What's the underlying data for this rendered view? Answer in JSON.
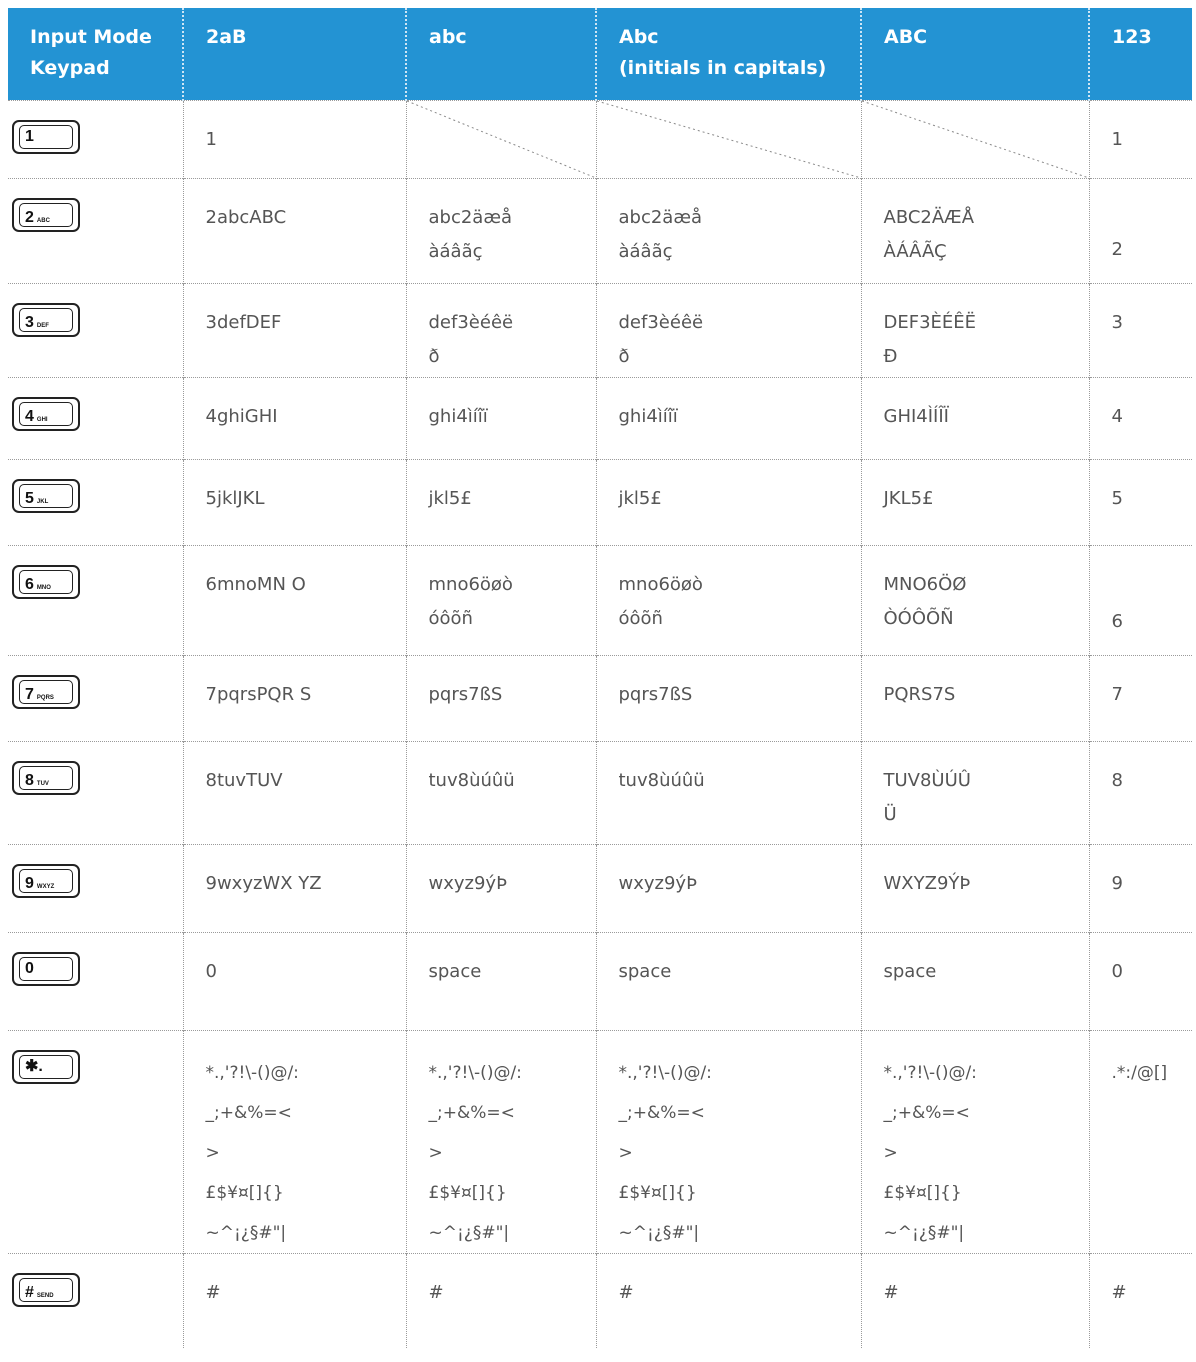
{
  "header": [
    "Input Mode\nKeypad",
    "2aB",
    "abc",
    "Abc\n(initials in capitals)",
    "ABC",
    "123"
  ],
  "rows": [
    {
      "key": {
        "digit": "1",
        "letters": ""
      },
      "cells": [
        "1",
        "",
        "",
        "",
        "1"
      ]
    },
    {
      "key": {
        "digit": "2",
        "letters": "ABC"
      },
      "cells": [
        "2abcABC",
        "abc2äæå\nàáâãç",
        "abc2äæå\nàáâãç",
        "ABC2ÄÆÅ\nÀÁÂÃÇ",
        "2"
      ]
    },
    {
      "key": {
        "digit": "3",
        "letters": "DEF"
      },
      "cells": [
        "3defDEF",
        "def3èéêë\nð",
        "def3èéêë\nð",
        "DEF3ÈÉÊË\nÐ",
        "3"
      ]
    },
    {
      "key": {
        "digit": "4",
        "letters": "GHI"
      },
      "cells": [
        "4ghiGHI",
        "ghi4ìíîï",
        "ghi4ìíîï",
        "GHI4ÌÍÎÏ",
        "4"
      ]
    },
    {
      "key": {
        "digit": "5",
        "letters": "JKL"
      },
      "cells": [
        "5jklJKL",
        "jkl5£",
        "jkl5£",
        "JKL5£",
        "5"
      ]
    },
    {
      "key": {
        "digit": "6",
        "letters": "MNO"
      },
      "cells": [
        "6mnoMN O",
        "mno6öøò\nóôõñ",
        "mno6öøò\nóôõñ",
        "MNO6ÖØ\nÒÓÔÕÑ",
        "6"
      ]
    },
    {
      "key": {
        "digit": "7",
        "letters": "PQRS"
      },
      "cells": [
        "7pqrsPQR S",
        "pqrs7ßS",
        "pqrs7ßS",
        "PQRS7S",
        "7"
      ]
    },
    {
      "key": {
        "digit": "8",
        "letters": "TUV"
      },
      "cells": [
        "8tuvTUV",
        "tuv8ùúûü",
        "tuv8ùúûü",
        "TUV8ÙÚÛ\nÜ",
        "8"
      ]
    },
    {
      "key": {
        "digit": "9",
        "letters": "WXYZ"
      },
      "cells": [
        "9wxyzWX YZ",
        "wxyz9ýÞ",
        "wxyz9ýÞ",
        "WXYZ9ÝÞ",
        "9"
      ]
    },
    {
      "key": {
        "digit": "0",
        "letters": ""
      },
      "cells": [
        "0",
        "space",
        "space",
        "space",
        "0"
      ]
    },
    {
      "key": {
        "digit": "✱.",
        "letters": ""
      },
      "cells": [
        "*.,'?!\\-()@/:\n_;+&%=<\n>\n£$¥¤[]{}\n~^¡¿§#\"|",
        "*.,'?!\\-()@/:\n_;+&%=<\n>\n£$¥¤[]{}\n~^¡¿§#\"|",
        "*.,'?!\\-()@/:\n_;+&%=<\n>\n£$¥¤[]{}\n~^¡¿§#\"|",
        "*.,'?!\\-()@/:\n_;+&%=<\n>\n£$¥¤[]{}\n~^¡¿§#\"|",
        ".*:/@[]"
      ]
    },
    {
      "key": {
        "digit": "#",
        "letters": "SEND"
      },
      "cells": [
        "#",
        "#",
        "#",
        "#",
        "#"
      ]
    }
  ]
}
